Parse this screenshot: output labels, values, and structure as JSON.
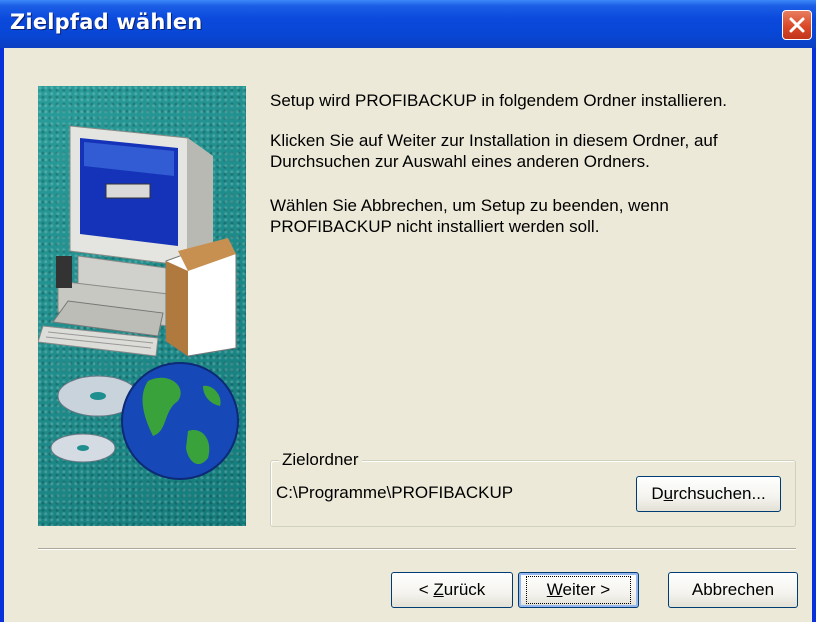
{
  "window": {
    "title": "Zielpfad wählen"
  },
  "content": {
    "line1": "Setup wird PROFIBACKUP in folgendem Ordner installieren.",
    "line2a": "Klicken Sie auf Weiter zur Installation in diesem Ordner, auf",
    "line2b": "Durchsuchen zur Auswahl eines anderen Ordners.",
    "line3a": "Wählen Sie Abbrechen, um Setup zu beenden, wenn",
    "line3b": "PROFIBACKUP nicht installiert werden soll."
  },
  "destination": {
    "group_label": "Zielordner",
    "path": "C:\\Programme\\PROFIBACKUP",
    "browse_pre": "D",
    "browse_key": "u",
    "browse_post": "rchsuchen..."
  },
  "buttons": {
    "back_pre": "< ",
    "back_key": "Z",
    "back_post": "urück",
    "next_key": "W",
    "next_post": "eiter >",
    "cancel": "Abbrechen"
  },
  "icons": {
    "close": "close-icon",
    "illustration": "computer-cd-globe-illustration"
  },
  "colors": {
    "titlebar": "#0a49dc",
    "close_button": "#d9492a",
    "dialog_background": "#ece9d8",
    "illustration_background": "#1e8e8e"
  }
}
